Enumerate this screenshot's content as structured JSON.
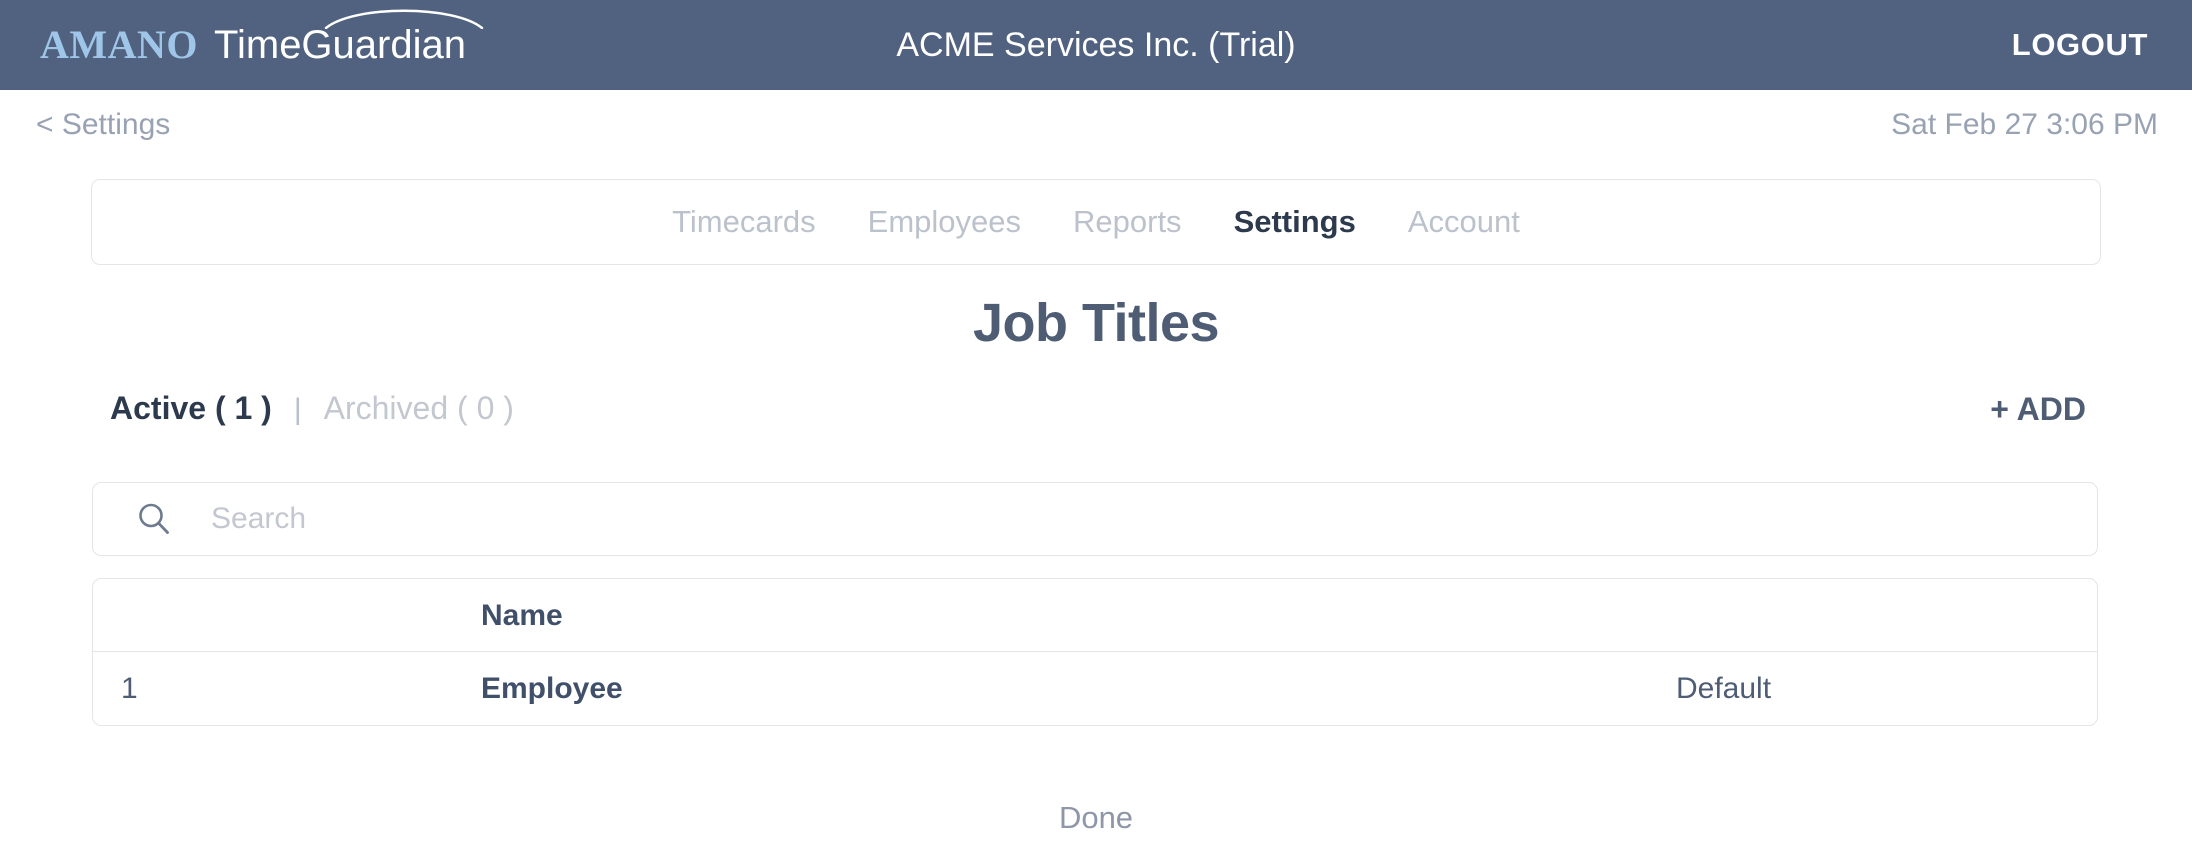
{
  "header": {
    "brand_primary": "AMANO",
    "brand_secondary": "TimeGuardian",
    "company_title": "ACME Services Inc. (Trial)",
    "logout_label": "LOGOUT",
    "bar_color": "#506280",
    "brand_primary_color": "#9fc6e8"
  },
  "subheader": {
    "back_label": "< Settings",
    "clock": "Sat Feb 27 3:06 PM"
  },
  "nav": {
    "tabs": [
      {
        "label": "Timecards",
        "active": false
      },
      {
        "label": "Employees",
        "active": false
      },
      {
        "label": "Reports",
        "active": false
      },
      {
        "label": "Settings",
        "active": true
      },
      {
        "label": "Account",
        "active": false
      }
    ]
  },
  "page": {
    "title": "Job Titles"
  },
  "filters": {
    "active_label": "Active ( 1 )",
    "separator": "|",
    "archived_label": "Archived ( 0 )",
    "add_label": "+ ADD"
  },
  "search": {
    "placeholder": "Search",
    "value": "",
    "icon": "search-icon"
  },
  "table": {
    "columns": [
      "",
      "Name",
      ""
    ],
    "header_name": "Name",
    "rows": [
      {
        "index": "1",
        "name": "Employee",
        "flag": "Default"
      }
    ]
  },
  "footer": {
    "done_label": "Done"
  }
}
